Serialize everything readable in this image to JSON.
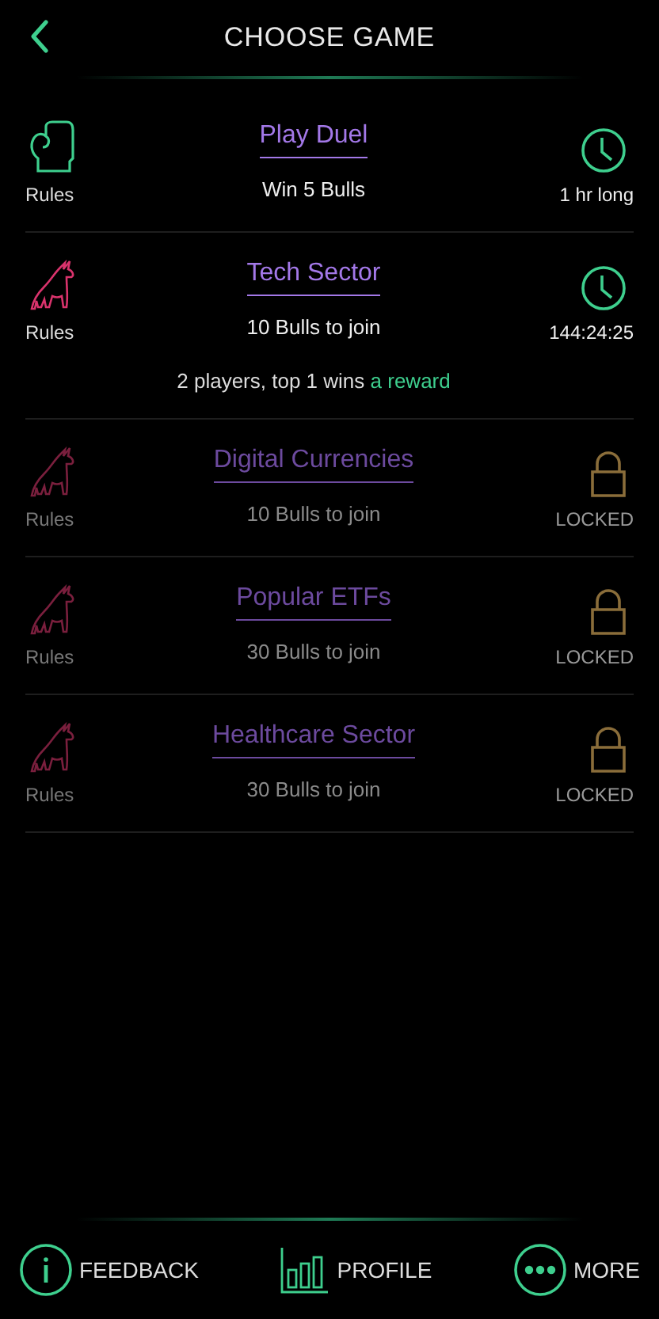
{
  "header": {
    "title": "CHOOSE GAME"
  },
  "games": [
    {
      "kind": "duel",
      "rules": "Rules",
      "title": "Play Duel",
      "subtitle": "Win 5 Bulls",
      "locked": false,
      "status": "1 hr long"
    },
    {
      "kind": "sector",
      "rules": "Rules",
      "title": "Tech Sector",
      "subtitle": "10 Bulls to join",
      "note": "2 players, top 1 wins",
      "note_link": "a reward",
      "locked": false,
      "status": "144:24:25"
    },
    {
      "kind": "sector",
      "rules": "Rules",
      "title": "Digital Currencies",
      "subtitle": "10 Bulls to join",
      "locked": true,
      "status": "LOCKED"
    },
    {
      "kind": "sector",
      "rules": "Rules",
      "title": "Popular ETFs",
      "subtitle": "30 Bulls to join",
      "locked": true,
      "status": "LOCKED"
    },
    {
      "kind": "sector",
      "rules": "Rules",
      "title": "Healthcare Sector",
      "subtitle": "30 Bulls to join",
      "locked": true,
      "status": "LOCKED"
    }
  ],
  "nav": [
    {
      "kind": "info",
      "label": "FEEDBACK"
    },
    {
      "kind": "chart",
      "label": "PROFILE"
    },
    {
      "kind": "more",
      "label": "MORE"
    }
  ]
}
